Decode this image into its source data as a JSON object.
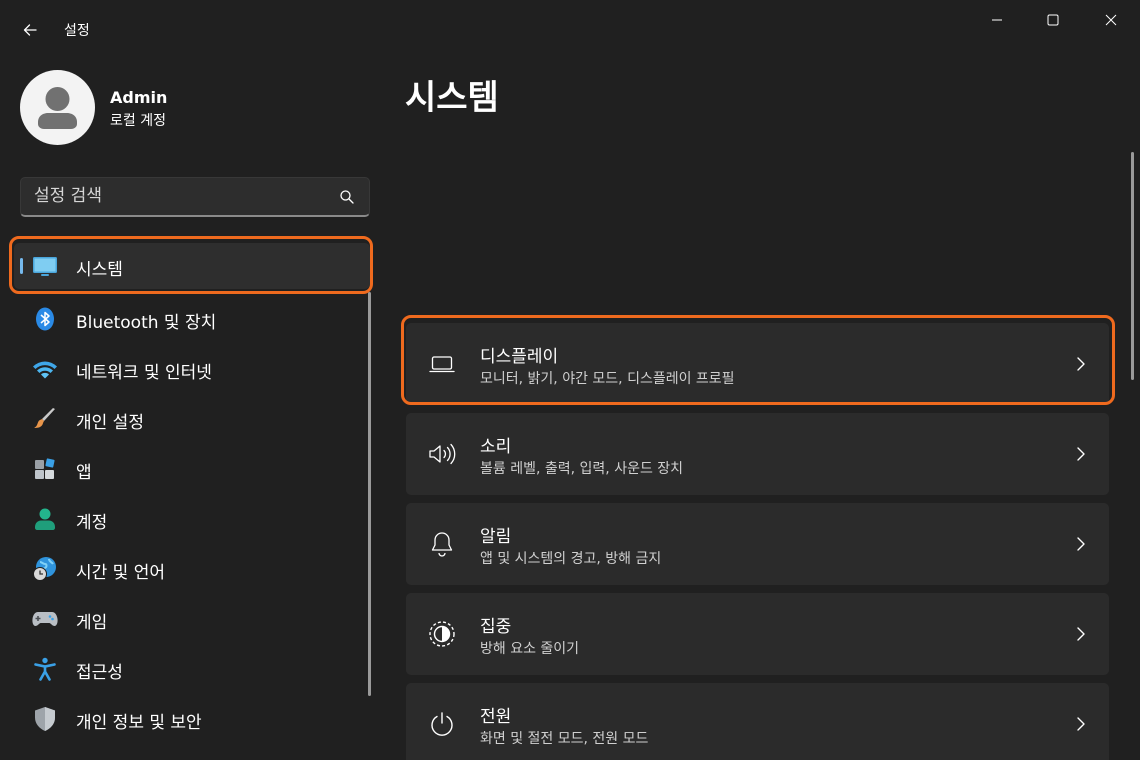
{
  "window": {
    "title": "설정",
    "accent_color": "#76b9ed",
    "highlight_color": "#ef6a1e"
  },
  "profile": {
    "name": "Admin",
    "account_type": "로컬 계정",
    "avatar_icon": "person-icon"
  },
  "search": {
    "placeholder": "설정 검색",
    "icon": "search-icon"
  },
  "sidebar": {
    "items": [
      {
        "label": "시스템",
        "icon": "monitor-icon",
        "selected": true
      },
      {
        "label": "Bluetooth 및 장치",
        "icon": "bluetooth-icon",
        "selected": false
      },
      {
        "label": "네트워크 및 인터넷",
        "icon": "wifi-icon",
        "selected": false
      },
      {
        "label": "개인 설정",
        "icon": "paintbrush-icon",
        "selected": false
      },
      {
        "label": "앱",
        "icon": "apps-icon",
        "selected": false
      },
      {
        "label": "계정",
        "icon": "account-icon",
        "selected": false
      },
      {
        "label": "시간 및 언어",
        "icon": "globe-clock-icon",
        "selected": false
      },
      {
        "label": "게임",
        "icon": "gamepad-icon",
        "selected": false
      },
      {
        "label": "접근성",
        "icon": "accessibility-icon",
        "selected": false
      },
      {
        "label": "개인 정보 및 보안",
        "icon": "shield-icon",
        "selected": false
      }
    ]
  },
  "main": {
    "title": "시스템",
    "cards": [
      {
        "title": "디스플레이",
        "subtitle": "모니터, 밝기, 야간 모드, 디스플레이 프로필",
        "icon": "laptop-icon"
      },
      {
        "title": "소리",
        "subtitle": "볼륨 레벨, 출력, 입력, 사운드 장치",
        "icon": "speaker-icon"
      },
      {
        "title": "알림",
        "subtitle": "앱 및 시스템의 경고, 방해 금지",
        "icon": "bell-icon"
      },
      {
        "title": "집중",
        "subtitle": "방해 요소 줄이기",
        "icon": "focus-icon"
      },
      {
        "title": "전원",
        "subtitle": "화면 및 절전 모드, 전원 모드",
        "icon": "power-icon"
      }
    ]
  }
}
